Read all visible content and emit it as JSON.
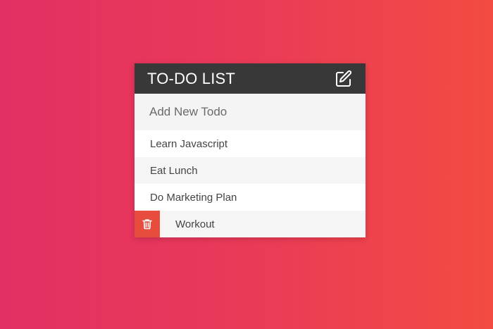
{
  "header": {
    "title": "TO-DO LIST",
    "edit_icon": "edit-icon"
  },
  "add_todo": {
    "placeholder": "Add New Todo"
  },
  "todos": [
    {
      "label": "Learn Javascript"
    },
    {
      "label": "Eat Lunch"
    },
    {
      "label": "Do Marketing Plan"
    },
    {
      "label": "Workout",
      "delete_visible": true,
      "delete_icon": "trash-icon"
    }
  ],
  "colors": {
    "header_bg": "#383838",
    "delete_bg": "#e74c3c",
    "gradient_left": "#e32f63",
    "gradient_right": "#f34b42"
  }
}
